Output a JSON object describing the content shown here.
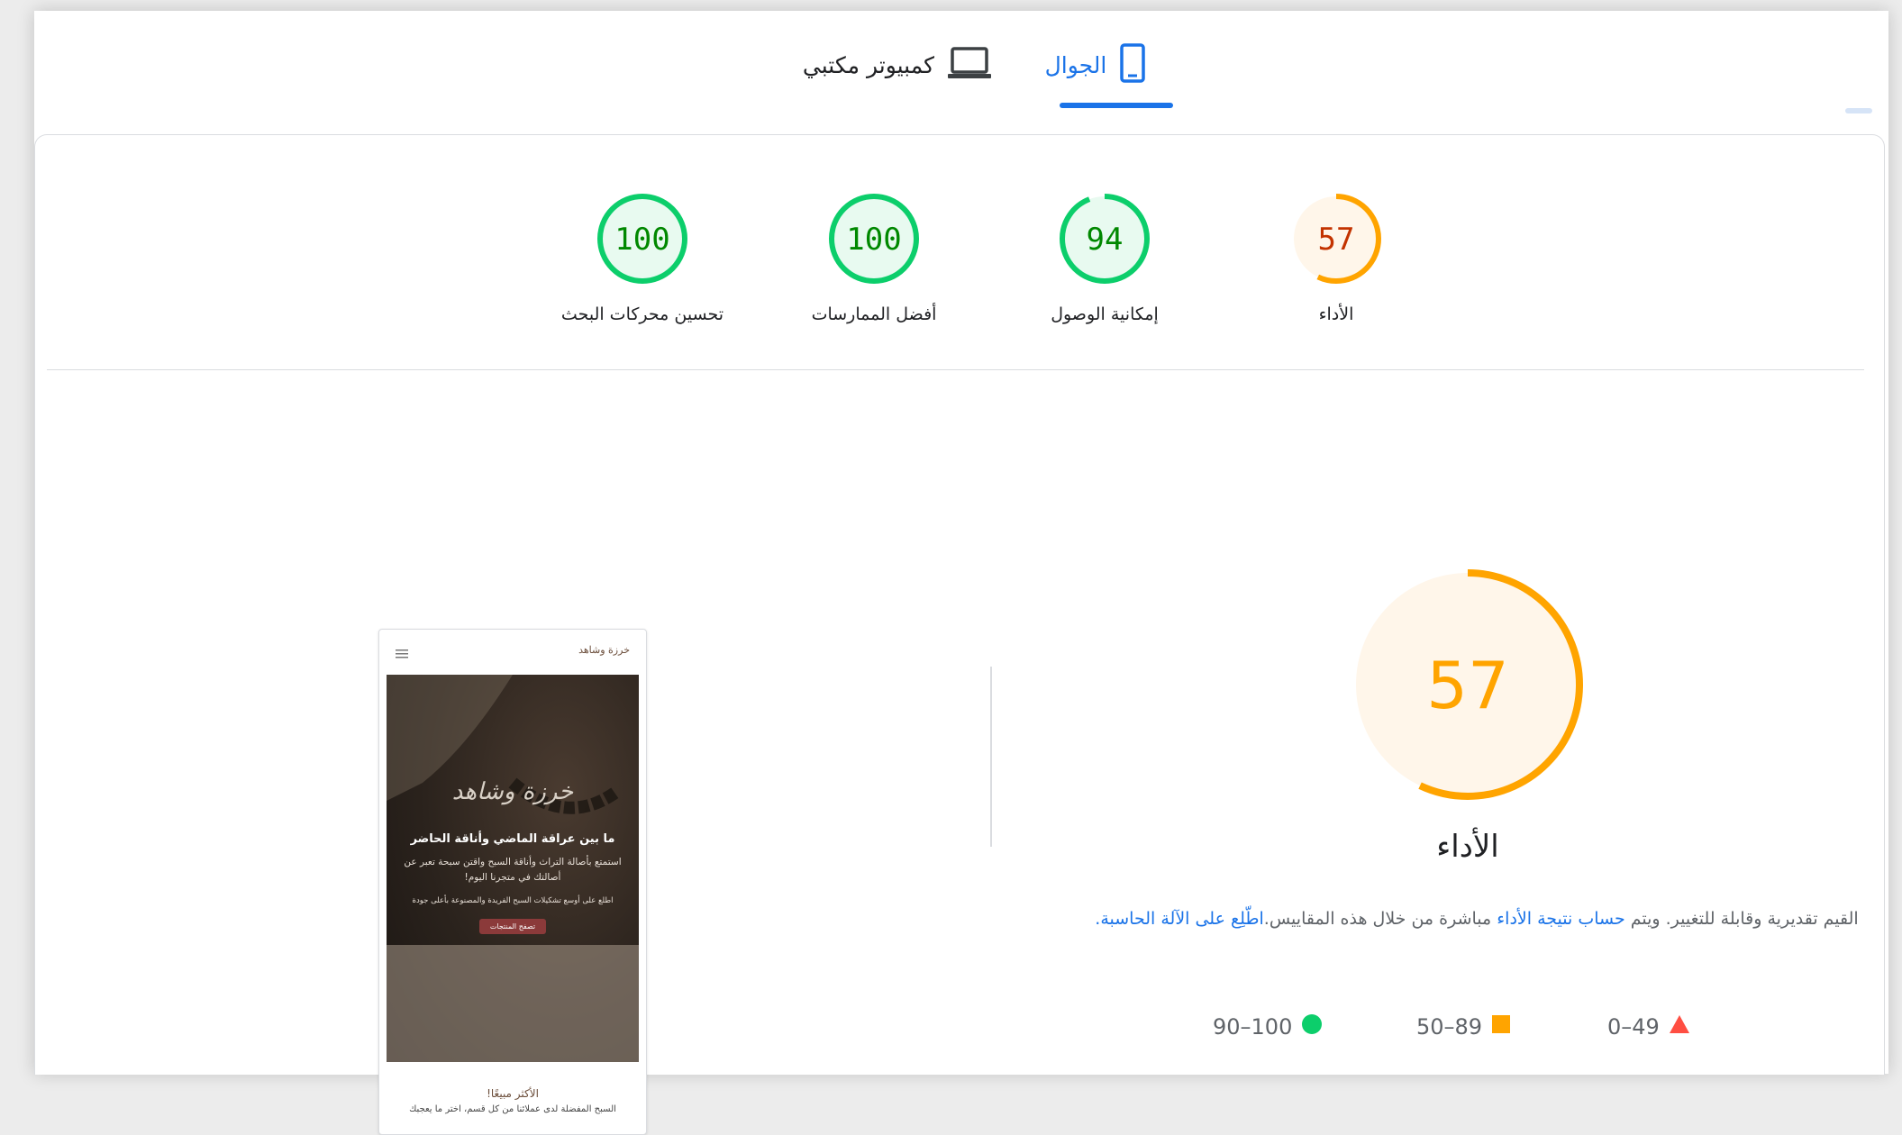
{
  "tabs": {
    "mobile": "الجوال",
    "desktop": "كمبيوتر مكتبي"
  },
  "scores": [
    {
      "label": "الأداء",
      "value": "57",
      "score": 0.57,
      "color": "#ffa400",
      "text_color": "#c33300",
      "bg": "#fff6ea"
    },
    {
      "label": "إمكانية الوصول",
      "value": "94",
      "score": 0.94,
      "color": "#0cce6b",
      "text_color": "#008800",
      "bg": "#e8faf0"
    },
    {
      "label": "أفضل الممارسات",
      "value": "100",
      "score": 1.0,
      "color": "#0cce6b",
      "text_color": "#008800",
      "bg": "#e8faf0"
    },
    {
      "label": "تحسين محركات البحث",
      "value": "100",
      "score": 1.0,
      "color": "#0cce6b",
      "text_color": "#008800",
      "bg": "#e8faf0"
    }
  ],
  "performance": {
    "value": "57",
    "score": 0.57,
    "title": "الأداء",
    "desc_1": "القيم تقديرية وقابلة للتغيير. ويتم ",
    "desc_link_1": "حساب نتيجة الأداء",
    "desc_2": " مباشرة من خلال هذه المقاييس.",
    "desc_link_2": "اطّلِع على الآلة الحاسبة."
  },
  "legend": {
    "red": "0–49",
    "orange": "50–89",
    "green": "90–100"
  },
  "colors": {
    "accent": "#1a73e8",
    "pass": "#0cce6b",
    "average": "#ffa400",
    "fail": "#ff4e42"
  },
  "thumbnail": {
    "brand": "خرزة وشاهد",
    "hero_title": "ما بين عراقة الماضي وأناقة الحاضر",
    "hero_sub": "استمتع بأصالة التراث وأناقة السبح واقتن سبحة تعبر عن أصالتك في متجرنا اليوم!",
    "hero_small": "اطلع على أوسع تشكيلات السبح الفريدة والمصنوعة بأعلى جودة",
    "hero_button": "تصفح المنتجات",
    "section_title": "الأكثر مبيعًا!",
    "section_desc": "السبح المفضلة لدى عملائنا من كل قسم، اختر ما يعجبك"
  }
}
